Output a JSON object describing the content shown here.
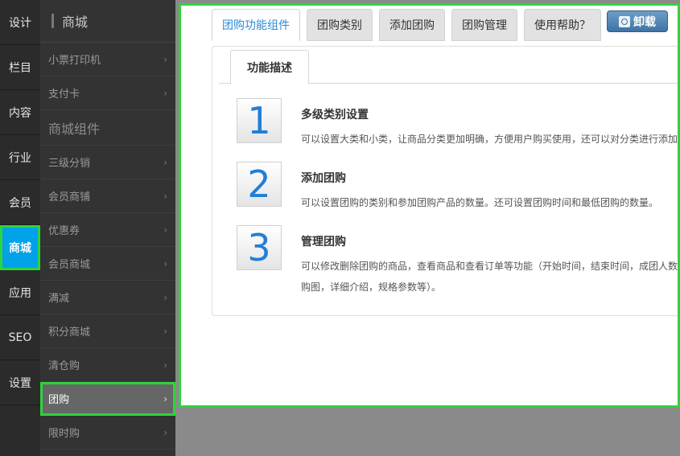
{
  "leftnav": {
    "items": [
      {
        "label": "设计"
      },
      {
        "label": "栏目"
      },
      {
        "label": "内容"
      },
      {
        "label": "行业"
      },
      {
        "label": "会员"
      },
      {
        "label": "商城"
      },
      {
        "label": "应用"
      },
      {
        "label": "SEO"
      },
      {
        "label": "设置"
      }
    ]
  },
  "subpanel": {
    "title": "商城",
    "items_top": [
      {
        "label": "小票打印机"
      },
      {
        "label": "支付卡"
      }
    ],
    "section_title": "商城组件",
    "items": [
      {
        "label": "三级分销"
      },
      {
        "label": "会员商铺"
      },
      {
        "label": "优惠券"
      },
      {
        "label": "会员商城"
      },
      {
        "label": "满减"
      },
      {
        "label": "积分商城"
      },
      {
        "label": "清仓购"
      },
      {
        "label": "团购"
      },
      {
        "label": "限时购"
      }
    ],
    "chevron": "›"
  },
  "content": {
    "tabs": [
      {
        "label": "团购功能组件"
      },
      {
        "label": "团购类别"
      },
      {
        "label": "添加团购"
      },
      {
        "label": "团购管理"
      },
      {
        "label": "使用帮助？"
      }
    ],
    "uninstall_label": "卸载",
    "subtab_label": "功能描述",
    "features": [
      {
        "num": "1",
        "title": "多级类别设置",
        "desc": "可以设置大类和小类，让商品分类更加明确，方便用户购买使用，还可以对分类进行添加"
      },
      {
        "num": "2",
        "title": "添加团购",
        "desc": "可以设置团购的类别和参加团购产品的数量。还可设置团购时间和最低团购的数量。"
      },
      {
        "num": "3",
        "title": "管理团购",
        "desc": "可以修改删除团购的商品，查看商品和查看订单等功能（开始时间，结束时间，成团人数，购图，详细介绍，规格参数等）。"
      }
    ]
  },
  "colors": {
    "accent_blue": "#00a2e8",
    "highlight_green": "#2ed33d",
    "number_blue": "#1f7fd8"
  }
}
